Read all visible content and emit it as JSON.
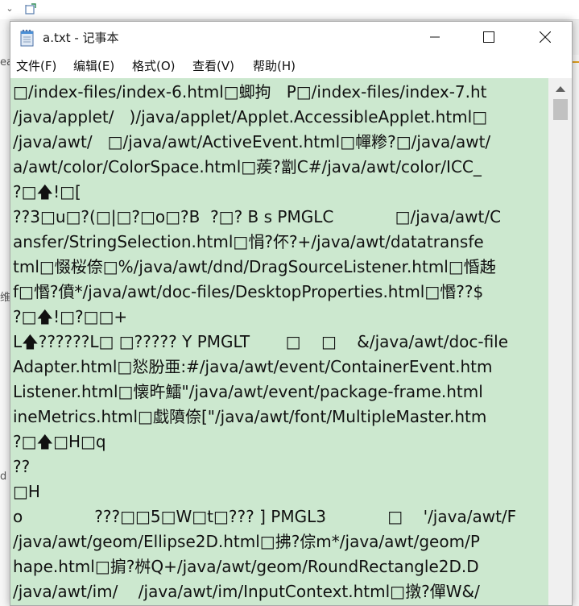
{
  "window": {
    "title": "a.txt - 记事本",
    "app_icon": "notepad-icon",
    "controls": [
      "minimize-icon",
      "maximize-icon",
      "close-icon"
    ]
  },
  "menu": [
    {
      "label": "文件(F)"
    },
    {
      "label": "编辑(E)"
    },
    {
      "label": "格式(O)"
    },
    {
      "label": "查看(V)"
    },
    {
      "label": "帮助(H)"
    }
  ],
  "editor": {
    "background": "#cce8cf",
    "lines": [
      "□/index-files/index-6.html□蝍拘   P□/index-files/index-7.ht",
      "/java/applet/   )/java/applet/Applet.AccessibleApplet.html□",
      "/java/awt/   □/java/awt/ActiveEvent.html□幝糁?□/java/awt/",
      "a/awt/color/ColorSpace.html□蒺?劏C#/java/awt/color/ICC_",
      "?□🡅!□[",
      "??3□u□?(□|□?□o□?B  ?□? B s PMGLC            □/java/awt/C",
      "ansfer/StringSelection.html□悁?伓?+/java/awt/datatransfe",
      "tml□惙桜倷□%/java/awt/dnd/DragSourceListener.html□惛趀",
      "f□惽?僨*/java/awt/doc-files/DesktopProperties.html□惽??$",
      "?□🡅!□?□□+",
      "L🡅??????L□ □????? Y PMGLT       □    □    &/java/awt/doc-file",
      "Adapter.html□悐肦亜:#/java/awt/event/ContainerEvent.htm",
      "Listener.html□懐旿鱩\"/java/awt/event/package-frame.html",
      "ineMetrics.html□戱隫倷[\"/java/awt/font/MultipleMaster.htm",
      "?□🡅□H□q",
      "??",
      "□H",
      "o              ???□□5□W□t□??? ] PMGL3            □    '/java/awt/F",
      "/java/awt/geom/Ellipse2D.html□拂?倧m*/java/awt/geom/P",
      "hape.html□掮?桝Q+/java/awt/geom/RoundRectangle2D.D",
      "/java/awt/im/    /java/awt/im/InputContext.html□撴?僤W&/"
    ]
  },
  "background": {
    "left_chars": [
      "ea",
      "维",
      "d"
    ]
  }
}
